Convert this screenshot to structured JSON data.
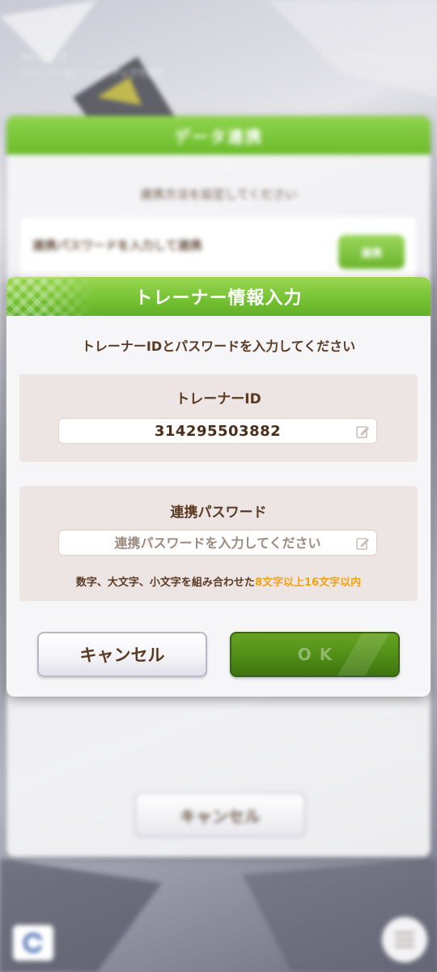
{
  "background": {
    "version": "Ver.2.24.0",
    "notice": "トレーナーID・バックアップで表示",
    "copyright": "©Cygames, Inc.",
    "dialog_title": "データ連携",
    "dialog_subtitle": "連携方法を設定してください",
    "row_label": "連携パスワードを入力して連携",
    "row_button": "連携",
    "cancel_label": "キャンセル"
  },
  "dialog": {
    "title": "トレーナー情報入力",
    "instruction": "トレーナーIDとパスワードを入力してください",
    "trainer_id": {
      "label": "トレーナーID",
      "value": "314295503882"
    },
    "password": {
      "label": "連携パスワード",
      "placeholder": "連携パスワードを入力してください",
      "hint_normal": "数字、大文字、小文字を組み合わせた",
      "hint_accent": "8文字以上16文字以内"
    },
    "cancel_label": "キャンセル",
    "ok_label": "OK"
  },
  "colors": {
    "header_green": "#77c335",
    "ok_green": "#4f8a16",
    "text_brown": "#5a3a22",
    "accent_orange": "#f2a20a"
  },
  "icons": [
    "edit-icon",
    "menu-icon",
    "hamburger-icon"
  ]
}
